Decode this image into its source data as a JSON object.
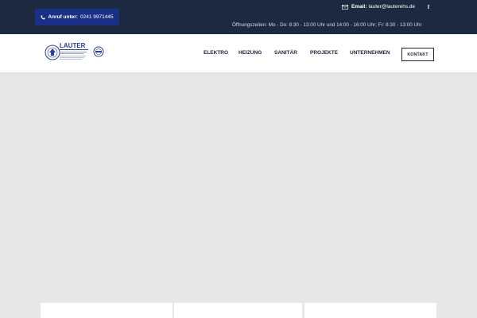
{
  "topbar": {
    "call_label": "Anruf unter:",
    "call_number": "0241 9971445",
    "email_label": "Email:",
    "email_address": "lauter@lauterehs.de",
    "hours": "Öffnungszeiten: Mo - Do: 8:30 - 13:00 Uhr und 14:00 - 16:00 Uhr; Fr: 8:30 - 13:00 Uhr",
    "icons": [
      "phone-icon",
      "mail-icon",
      "facebook-icon"
    ],
    "background_color": "#1d2940",
    "pill_color": "#1a2f86"
  },
  "header": {
    "logo_text": "LAUTER",
    "nav": [
      {
        "label": "ELEKTRO"
      },
      {
        "label": "HEIZUNG"
      },
      {
        "label": "SANITÄR"
      },
      {
        "label": "PROJEKTE"
      },
      {
        "label": "UNTERNEHMEN"
      }
    ],
    "kontakt_label": "KONTAKT",
    "text_color": "#1b2238"
  },
  "hero": {
    "background_color": "#e7e7e7"
  }
}
